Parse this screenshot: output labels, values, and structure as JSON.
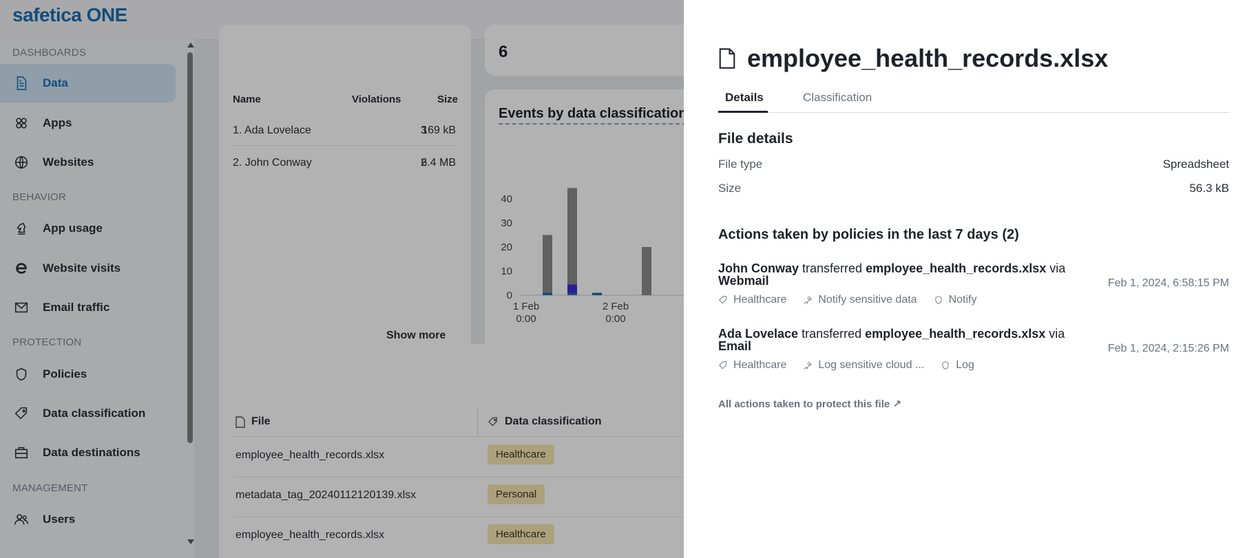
{
  "brand": {
    "logo_text": "safetica ONE"
  },
  "sidebar": {
    "sections": [
      "DASHBOARDS",
      "BEHAVIOR",
      "PROTECTION",
      "MANAGEMENT"
    ],
    "items": [
      {
        "label": "Data",
        "icon": "document-icon",
        "active": true
      },
      {
        "label": "Apps",
        "icon": "apps-icon"
      },
      {
        "label": "Websites",
        "icon": "globe-icon"
      },
      {
        "label": "App usage",
        "icon": "chess-knight-icon"
      },
      {
        "label": "Website visits",
        "icon": "browser-e-icon"
      },
      {
        "label": "Email traffic",
        "icon": "envelope-icon"
      },
      {
        "label": "Policies",
        "icon": "shield-icon"
      },
      {
        "label": "Data classification",
        "icon": "tag-icon"
      },
      {
        "label": "Data destinations",
        "icon": "briefcase-icon"
      },
      {
        "label": "Users",
        "icon": "users-icon"
      }
    ]
  },
  "users_card": {
    "headers": {
      "name": "Name",
      "violations": "Violations",
      "size": "Size"
    },
    "rows": [
      {
        "name": "1. Ada Lovelace",
        "violations": "3",
        "size": "169 kB"
      },
      {
        "name": "2. John Conway",
        "violations": "2",
        "size": "6.4 MB"
      }
    ],
    "show_more": "Show more"
  },
  "count_card": {
    "value": "6"
  },
  "chart_card": {
    "title": "Events by data classification"
  },
  "chart_data": {
    "type": "bar",
    "title": "Events by data classification",
    "x_tick_labels": [
      {
        "l1": "1 Feb",
        "l2": "0:00"
      },
      {
        "l1": "2 Feb",
        "l2": "0:00"
      }
    ],
    "y_ticks": [
      0,
      10,
      20,
      30,
      40
    ],
    "ylim": [
      0,
      40
    ],
    "series_colors": {
      "grey": "#8c8c8c",
      "blue": "#1b6fb3",
      "indigo": "#3b2bd1"
    },
    "bars": [
      {
        "slot": 0,
        "grey": 24,
        "blue": 1,
        "indigo": 0
      },
      {
        "slot": 1,
        "grey": 40,
        "blue": 1,
        "indigo": 3.5
      },
      {
        "slot": 2,
        "grey": 0,
        "blue": 1,
        "indigo": 0
      },
      {
        "slot": 4,
        "grey": 20,
        "blue": 0,
        "indigo": 0
      }
    ],
    "grid": false
  },
  "files_table": {
    "headers": {
      "file": "File",
      "classification": "Data classification"
    },
    "rows": [
      {
        "file": "employee_health_records.xlsx",
        "classification": "Healthcare",
        "badge_color": "#f7e7b3"
      },
      {
        "file": "metadata_tag_20240112120139.xlsx",
        "classification": "Personal",
        "badge_color": "#f7e4b1"
      },
      {
        "file": "employee_health_records.xlsx",
        "classification": "Healthcare",
        "badge_color": "#f7e7b3"
      }
    ]
  },
  "panel": {
    "title": "employee_health_records.xlsx",
    "tabs": [
      {
        "label": "Details",
        "active": true
      },
      {
        "label": "Classification"
      }
    ],
    "file_details": {
      "title": "File details",
      "rows": [
        {
          "key": "File type",
          "value": "Spreadsheet"
        },
        {
          "key": "Size",
          "value": "56.3 kB"
        }
      ]
    },
    "actions": {
      "title": "Actions taken by policies in the last 7 days (2)",
      "items": [
        {
          "user": "John Conway",
          "verb": "transferred",
          "file": "employee_health_records.xlsx",
          "via": "via",
          "channel": "Webmail",
          "classification": "Healthcare",
          "policy": "Notify sensitive data",
          "action": "Notify",
          "time": "Feb 1, 2024, 6:58:15 PM"
        },
        {
          "user": "Ada Lovelace",
          "verb": "transferred",
          "file": "employee_health_records.xlsx",
          "via": "via",
          "channel": "Email",
          "classification": "Healthcare",
          "policy": "Log sensitive cloud ...",
          "action": "Log",
          "time": "Feb 1, 2024, 2:15:26 PM"
        }
      ]
    },
    "all_actions_link": "All actions taken to protect this file ↗"
  }
}
